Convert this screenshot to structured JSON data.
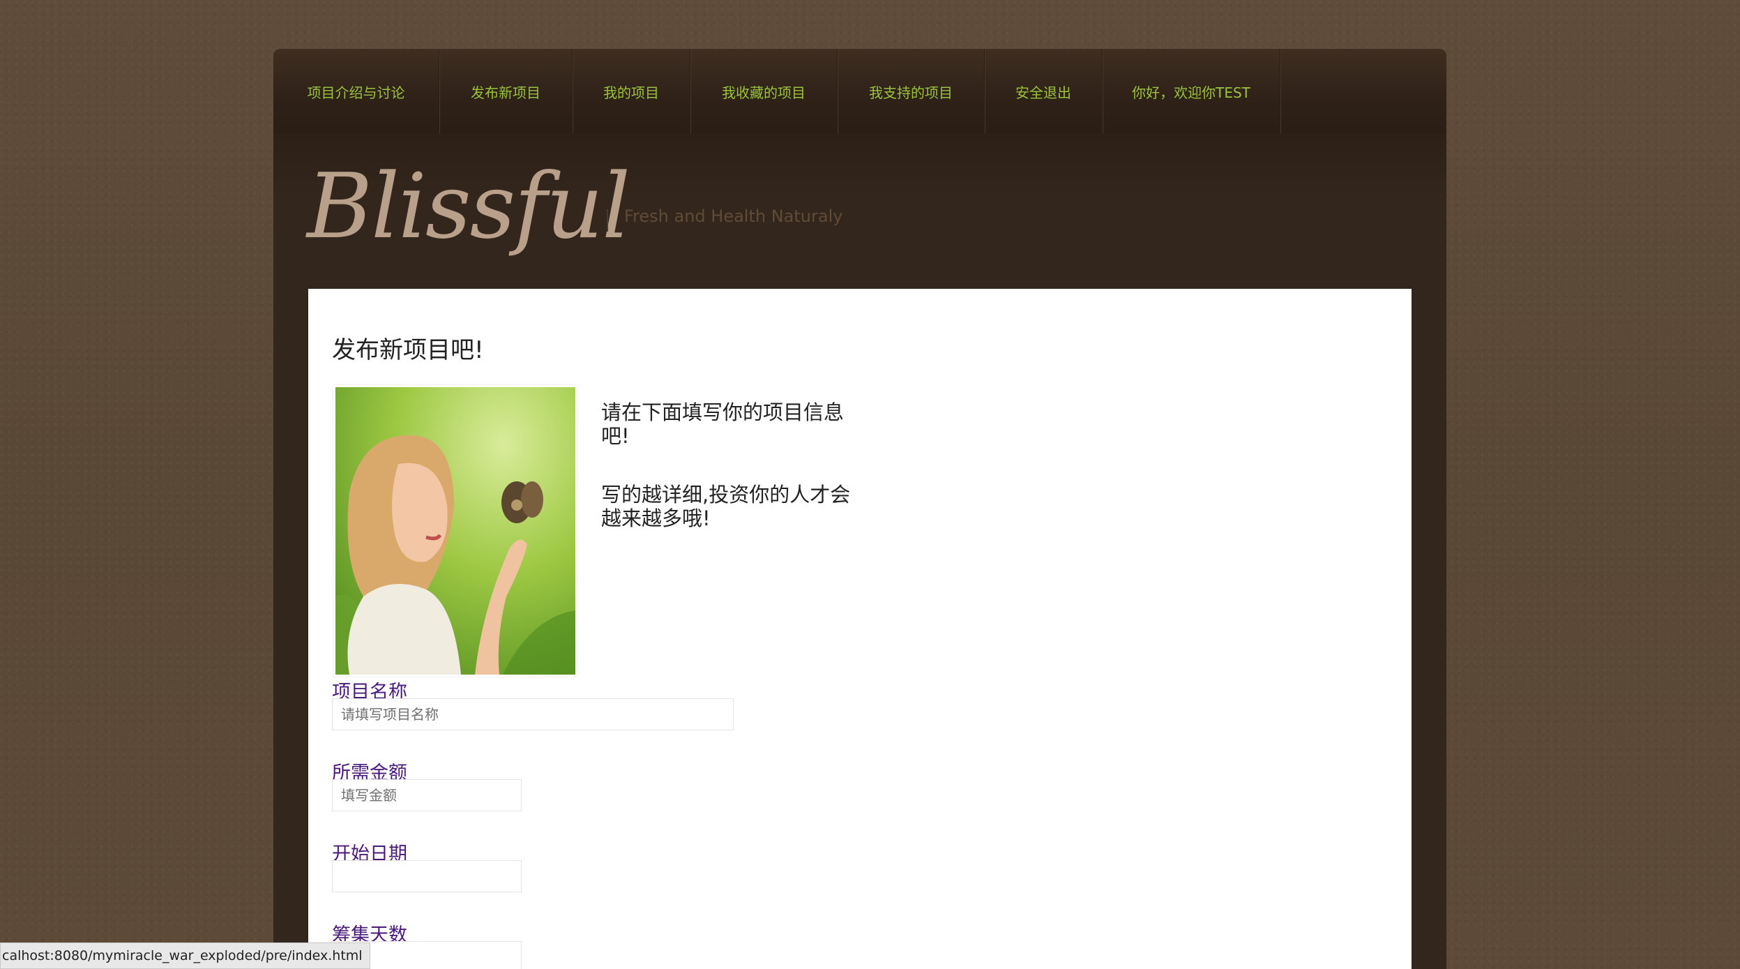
{
  "nav": {
    "items": [
      {
        "label": "项目介绍与讨论"
      },
      {
        "label": "发布新项目"
      },
      {
        "label": "我的项目"
      },
      {
        "label": "我收藏的项目"
      },
      {
        "label": "我支持的项目"
      },
      {
        "label": "安全退出"
      },
      {
        "label": "你好，欢迎你TEST"
      }
    ]
  },
  "header": {
    "logo_text": "Blissful",
    "tagline": "Fresh and Health Naturaly"
  },
  "main": {
    "title": "发布新项目吧!",
    "intro": {
      "line1": "请在下面填写你的项目信息吧!",
      "line2": "写的越详细,投资你的人才会越来越多哦!"
    },
    "fields": {
      "project_name": {
        "label": "项目名称",
        "placeholder": "请填写项目名称"
      },
      "amount": {
        "label": "所需金额",
        "placeholder": "填写金额"
      },
      "start_date": {
        "label": "开始日期",
        "placeholder": ""
      },
      "days": {
        "label": "筹集天数",
        "placeholder": ""
      }
    }
  },
  "statusbar": {
    "url": "calhost:8080/mymiracle_war_exploded/pre/index.html"
  },
  "colors": {
    "nav_link": "#9ac43b",
    "field_label": "#4a1a7a",
    "page_bg": "#33261c",
    "body_bg": "#5c4a38"
  }
}
